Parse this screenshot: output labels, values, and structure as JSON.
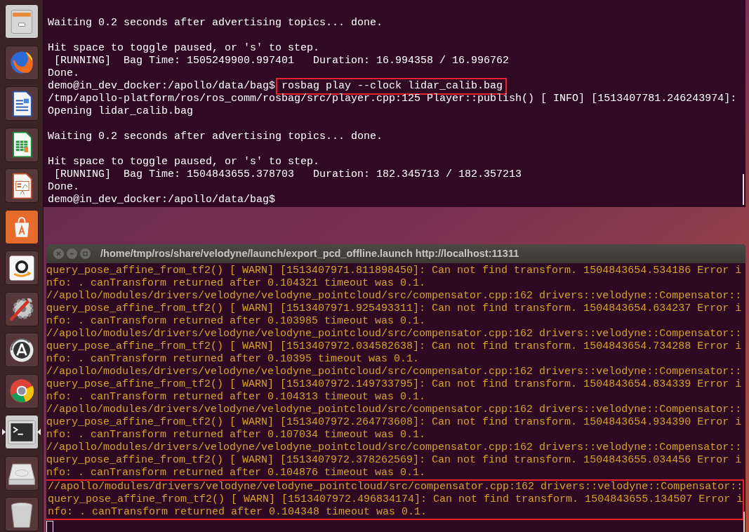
{
  "launcher": [
    {
      "kind": "files",
      "active": false
    },
    {
      "kind": "firefox",
      "active": false
    },
    {
      "kind": "writer",
      "active": false
    },
    {
      "kind": "calc",
      "active": false
    },
    {
      "kind": "impress",
      "active": false
    },
    {
      "kind": "store",
      "active": false
    },
    {
      "kind": "amazon",
      "active": false
    },
    {
      "kind": "settings",
      "active": false
    },
    {
      "kind": "updater",
      "active": false
    },
    {
      "kind": "chrome",
      "active": false
    },
    {
      "kind": "terminal",
      "active": true
    },
    {
      "kind": "disk",
      "active": false
    },
    {
      "kind": "trash",
      "active": false
    }
  ],
  "top_terminal": {
    "lines": [
      {
        "kind": "text",
        "text": "Waiting 0.2 seconds after advertising topics... done."
      },
      {
        "kind": "blank"
      },
      {
        "kind": "text",
        "text": "Hit space to toggle paused, or 's' to step."
      },
      {
        "kind": "text",
        "text": " [RUNNING]  Bag Time: 1505249900.997401   Duration: 16.994358 / 16.996762"
      },
      {
        "kind": "text",
        "text": "Done."
      },
      {
        "kind": "prompt",
        "prompt": "demo@in_dev_docker:/apollo/data/bag$",
        "command": "rosbag play --clock lidar_calib.bag",
        "highlighted": true
      },
      {
        "kind": "text",
        "text": "/tmp/apollo-platform/ros/ros_comm/rosbag/src/player.cpp:125 Player::publish() [ INFO] [1513407781.246243974]:"
      },
      {
        "kind": "text",
        "text": "Opening lidar_calib.bag"
      },
      {
        "kind": "blank"
      },
      {
        "kind": "text",
        "text": "Waiting 0.2 seconds after advertising topics... done."
      },
      {
        "kind": "blank"
      },
      {
        "kind": "text",
        "text": "Hit space to toggle paused, or 's' to step."
      },
      {
        "kind": "text",
        "text": " [RUNNING]  Bag Time: 1504843655.378703   Duration: 182.345713 / 182.357213"
      },
      {
        "kind": "text",
        "text": "Done."
      },
      {
        "kind": "prompt",
        "prompt": "demo@in_dev_docker:/apollo/data/bag$"
      }
    ]
  },
  "log_window": {
    "title": "/home/tmp/ros/share/velodyne/launch/export_pcd_offline.launch http://localhost:11311",
    "messages": [
      {
        "highlighted": false,
        "lines": [
          "query_pose_affine_from_tf2() [ WARN] [1513407971.811898450]: Can not find transform. 1504843654.534186 Error i",
          "nfo: . canTransform returned after 0.104321 timeout was 0.1."
        ]
      },
      {
        "highlighted": false,
        "lines": [
          "//apollo/modules/drivers/velodyne/velodyne_pointcloud/src/compensator.cpp:162 drivers::velodyne::Compensator::",
          "query_pose_affine_from_tf2() [ WARN] [1513407971.925493311]: Can not find transform. 1504843654.634237 Error i",
          "nfo: . canTransform returned after 0.103985 timeout was 0.1."
        ]
      },
      {
        "highlighted": false,
        "lines": [
          "//apollo/modules/drivers/velodyne/velodyne_pointcloud/src/compensator.cpp:162 drivers::velodyne::Compensator::",
          "query_pose_affine_from_tf2() [ WARN] [1513407972.034582638]: Can not find transform. 1504843654.734288 Error i",
          "nfo: . canTransform returned after 0.10395 timeout was 0.1."
        ]
      },
      {
        "highlighted": false,
        "lines": [
          "//apollo/modules/drivers/velodyne/velodyne_pointcloud/src/compensator.cpp:162 drivers::velodyne::Compensator::",
          "query_pose_affine_from_tf2() [ WARN] [1513407972.149733795]: Can not find transform. 1504843654.834339 Error i",
          "nfo: . canTransform returned after 0.104313 timeout was 0.1."
        ]
      },
      {
        "highlighted": false,
        "lines": [
          "//apollo/modules/drivers/velodyne/velodyne_pointcloud/src/compensator.cpp:162 drivers::velodyne::Compensator::",
          "query_pose_affine_from_tf2() [ WARN] [1513407972.264773608]: Can not find transform. 1504843654.934390 Error i",
          "nfo: . canTransform returned after 0.107034 timeout was 0.1."
        ]
      },
      {
        "highlighted": false,
        "lines": [
          "//apollo/modules/drivers/velodyne/velodyne_pointcloud/src/compensator.cpp:162 drivers::velodyne::Compensator::",
          "query_pose_affine_from_tf2() [ WARN] [1513407972.378262569]: Can not find transform. 1504843655.034456 Error i",
          "nfo: . canTransform returned after 0.104876 timeout was 0.1."
        ]
      },
      {
        "highlighted": true,
        "lines": [
          "//apollo/modules/drivers/velodyne/velodyne_pointcloud/src/compensator.cpp:162 drivers::velodyne::Compensator::",
          "query_pose_affine_from_tf2() [ WARN] [1513407972.496834174]: Can not find transform. 1504843655.134507 Error i",
          "nfo: . canTransform returned after 0.104348 timeout was 0.1."
        ]
      }
    ]
  }
}
